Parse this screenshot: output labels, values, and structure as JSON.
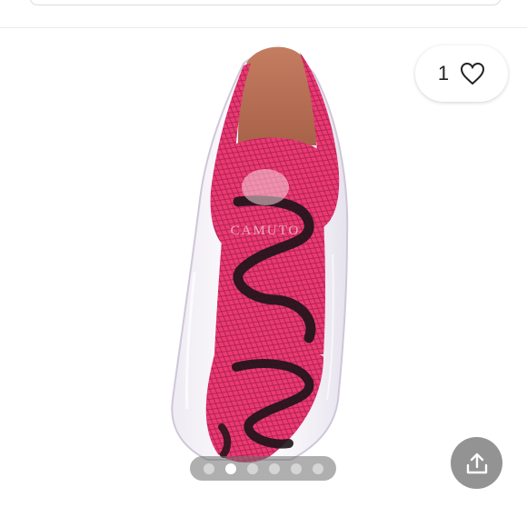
{
  "like": {
    "count": "1",
    "icon": "heart-icon"
  },
  "share": {
    "icon": "share-icon"
  },
  "carousel": {
    "total": 6,
    "active_index": 1
  },
  "product_image": {
    "brand_print": "CAMUTO",
    "colors": {
      "snake": "#e9336f",
      "snake_dark": "#1d1418",
      "sole": "#b8735a"
    }
  }
}
